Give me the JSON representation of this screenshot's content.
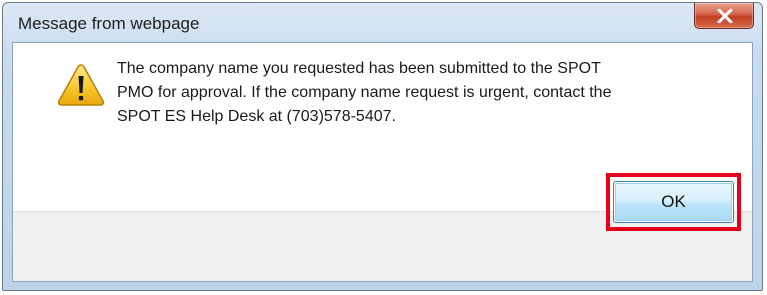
{
  "dialog": {
    "title": "Message from webpage",
    "close_icon": "close-icon",
    "warning_icon": "warning-icon",
    "message": "The company name you requested has been submitted to the SPOT PMO for approval. If the company name request is urgent, contact the SPOT ES Help Desk at (703)578-5407.",
    "message_lines": [
      "The company name you requested has been submitted to the SPOT",
      "PMO for approval. If the company name request is urgent, contact the",
      "SPOT ES Help Desk at (703)578-5407."
    ],
    "ok_label": "OK"
  },
  "colors": {
    "highlight_box": "#e2001a",
    "close_button": "#c33f24",
    "warning_yellow": "#f7c62a"
  }
}
